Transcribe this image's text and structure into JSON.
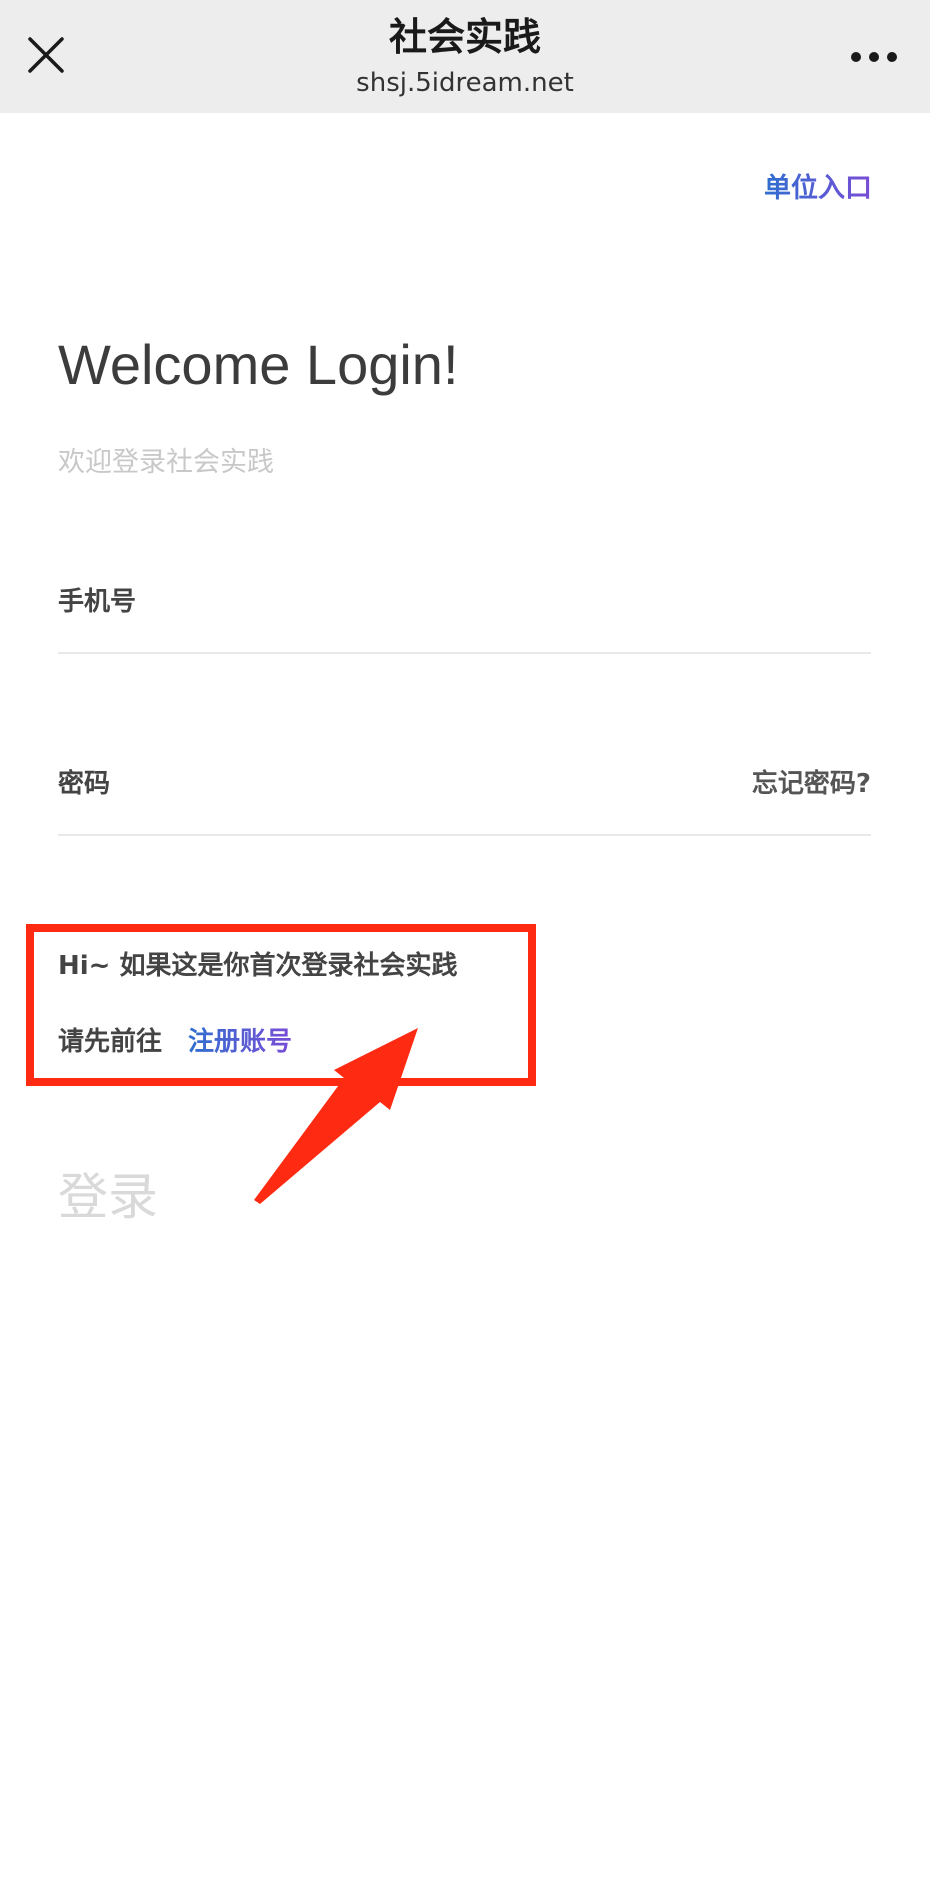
{
  "topbar": {
    "title": "社会实践",
    "url": "shsj.5idream.net",
    "close_icon": "close-icon",
    "more_icon": "more-dots-icon"
  },
  "header": {
    "org_entry": "单位入口"
  },
  "welcome": {
    "title": "Welcome Login!",
    "subtitle": "欢迎登录社会实践"
  },
  "form": {
    "phone_label": "手机号",
    "phone_value": "",
    "password_label": "密码",
    "password_value": "",
    "forgot_label": "忘记密码?",
    "login_label": "登录"
  },
  "notice": {
    "line1": "Hi~ 如果这是你首次登录社会实践",
    "line2": "请先前往",
    "register_label": "注册账号"
  },
  "colors": {
    "annotation_red": "#ff2a12",
    "link_blue": "#2f6fcf",
    "link_purple": "#7a4cd6",
    "topbar_bg": "#ededed"
  }
}
